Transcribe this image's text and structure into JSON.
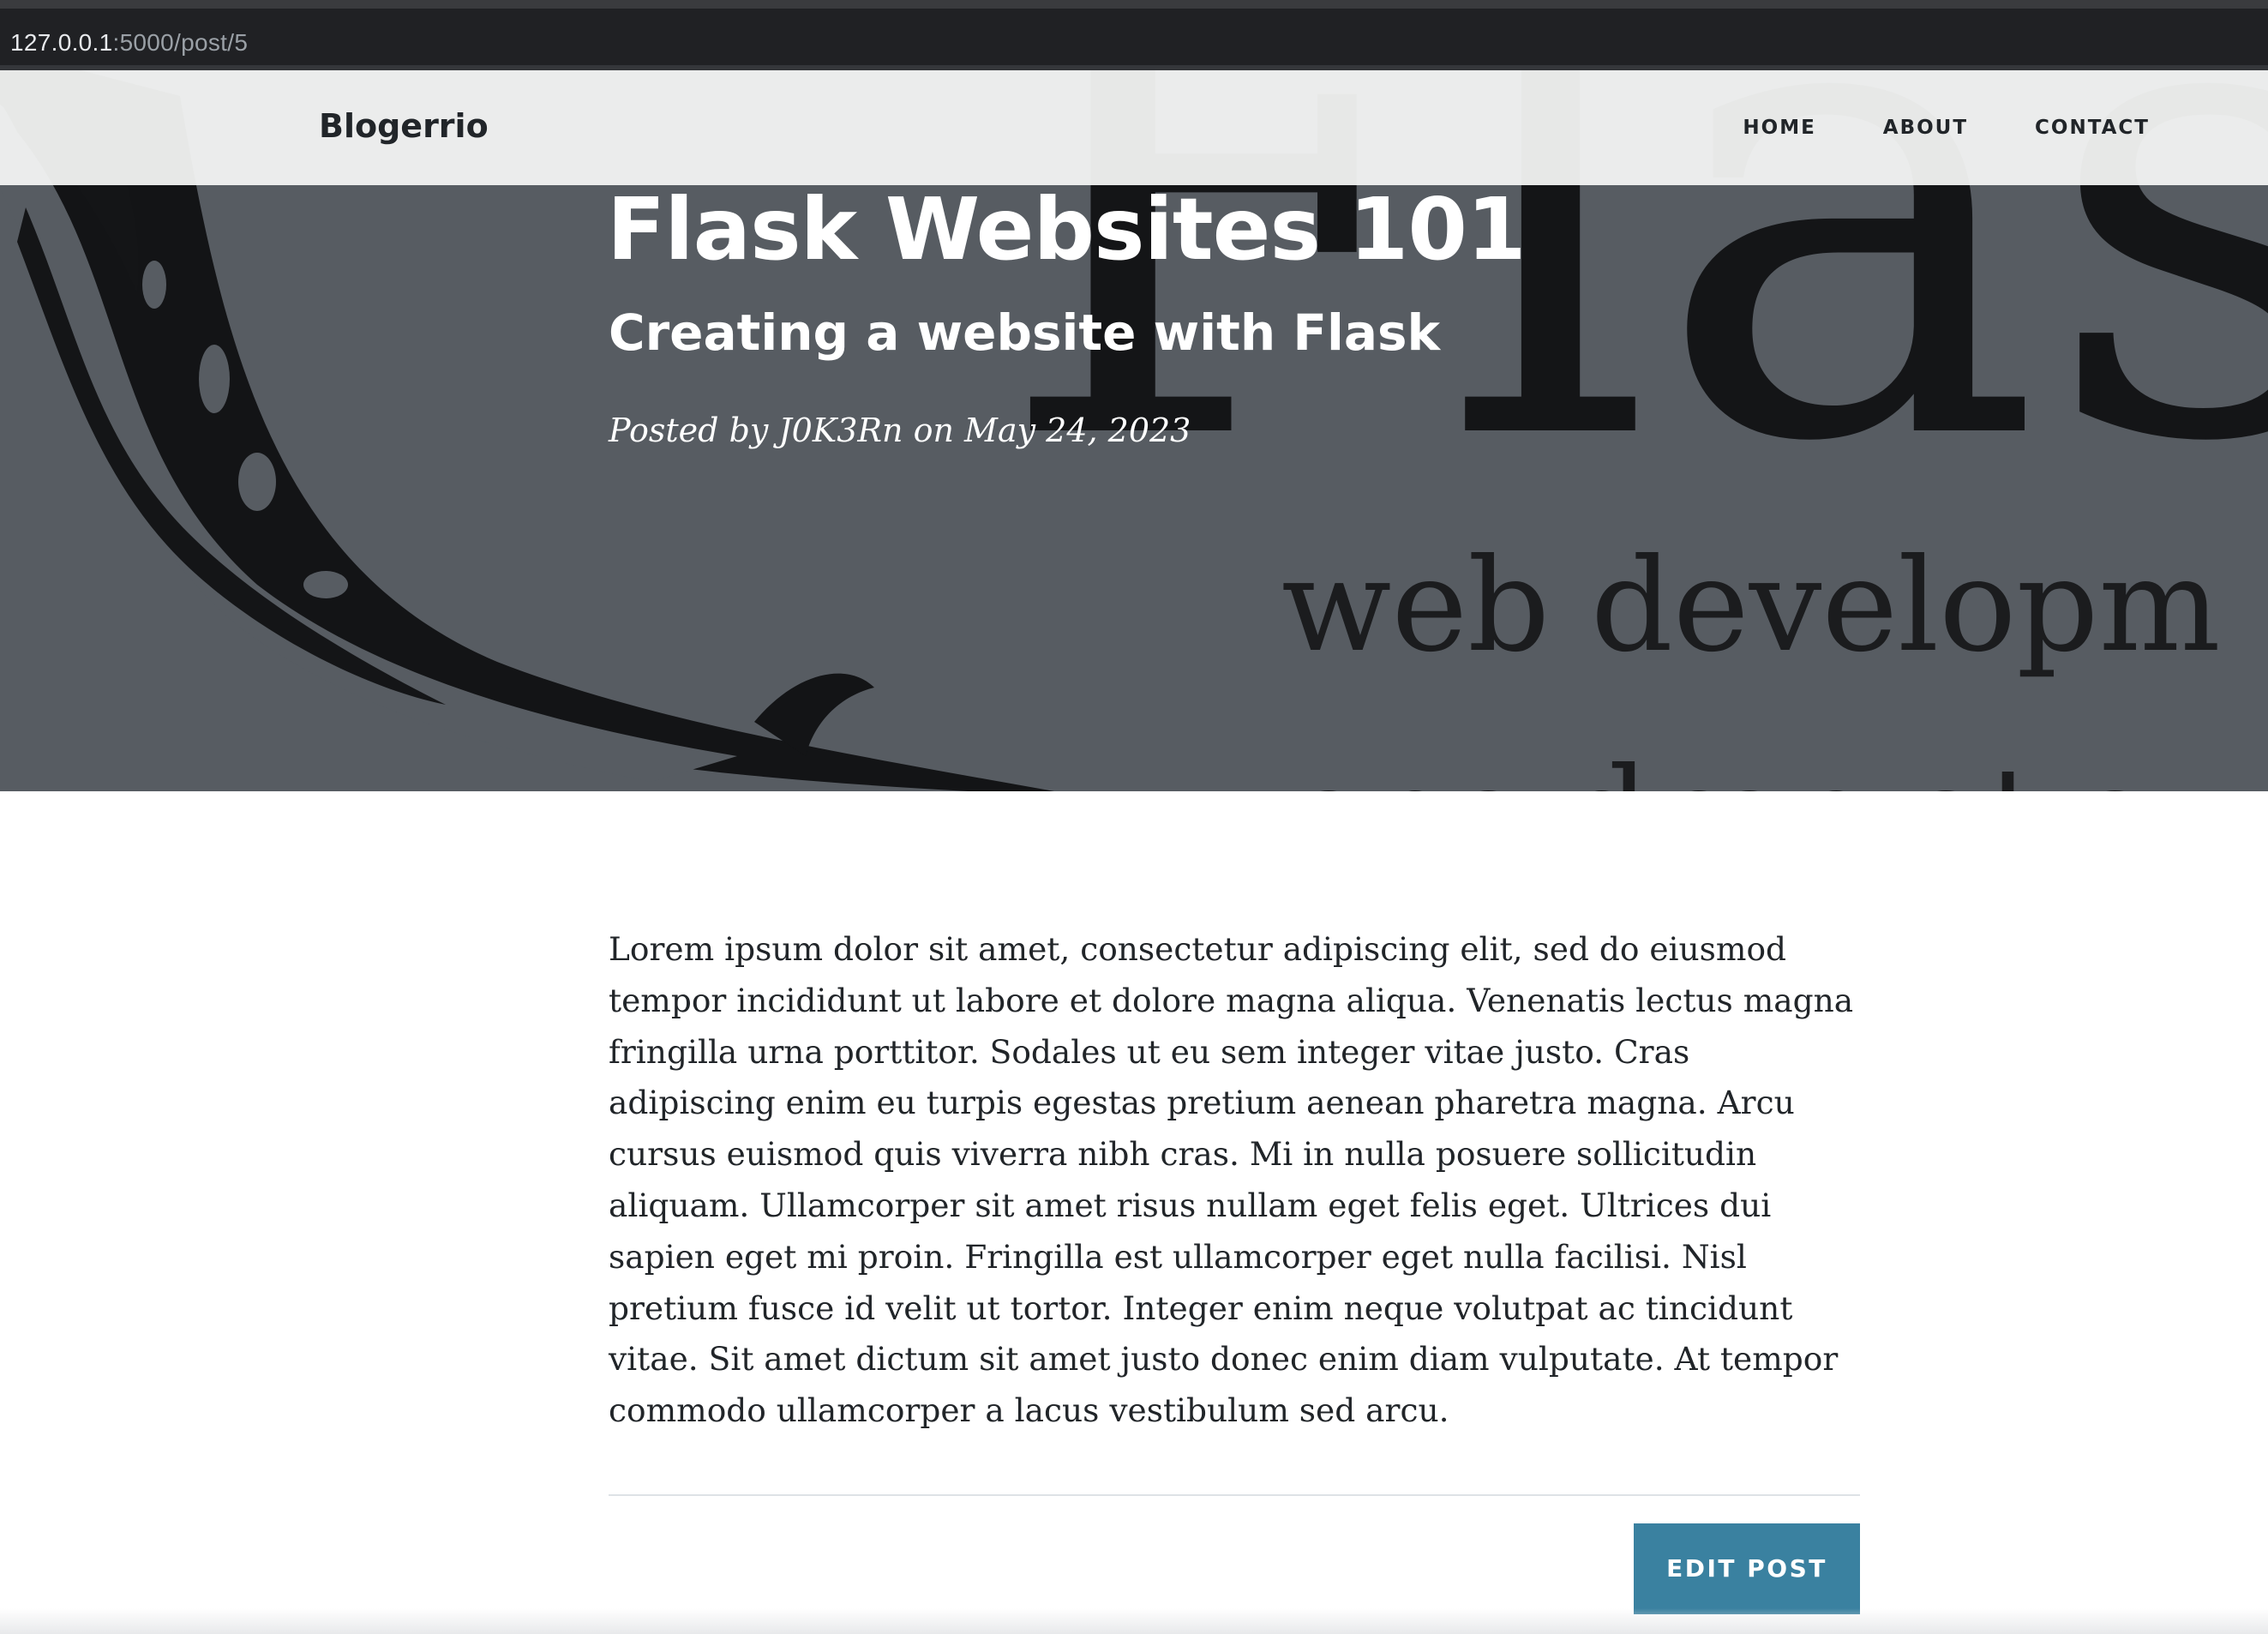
{
  "browser": {
    "url_host": "127.0.0.1",
    "url_path": ":5000/post/5"
  },
  "navbar": {
    "brand": "Blogerrio",
    "links": [
      {
        "label": "HOME"
      },
      {
        "label": "ABOUT"
      },
      {
        "label": "CONTACT"
      }
    ]
  },
  "hero": {
    "title": "Flask Websites 101",
    "subtitle": "Creating a website with Flask",
    "posted_by_prefix": "Posted by ",
    "author": "J0K3Rn",
    "date_prefix": " on ",
    "date": "May 24, 2023",
    "background_art": {
      "word": "Flask",
      "tagline_line1": "web developm",
      "tagline_line2": "one drop at a"
    }
  },
  "article": {
    "body": "Lorem ipsum dolor sit amet, consectetur adipiscing elit, sed do eiusmod tempor incididunt ut labore et dolore magna aliqua. Venenatis lectus magna fringilla urna porttitor. Sodales ut eu sem integer vitae justo. Cras adipiscing enim eu turpis egestas pretium aenean pharetra magna. Arcu cursus euismod quis viverra nibh cras. Mi in nulla posuere sollicitudin aliquam. Ullamcorper sit amet risus nullam eget felis eget. Ultrices dui sapien eget mi proin. Fringilla est ullamcorper eget nulla facilisi. Nisl pretium fusce id velit ut tortor. Integer enim neque volutpat ac tincidunt vitae. Sit amet dictum sit amet justo donec enim diam vulputate. At tempor commodo ullamcorper a lacus vestibulum sed arcu.",
    "edit_button_label": "EDIT POST"
  },
  "colors": {
    "hero_overlay": "#575c62",
    "navbar_bg": "#f4f5f4",
    "text_dark": "#212529",
    "button": "#3a81a0"
  },
  "icons": {
    "hero_art": "flask-logo-horn-illustration"
  }
}
